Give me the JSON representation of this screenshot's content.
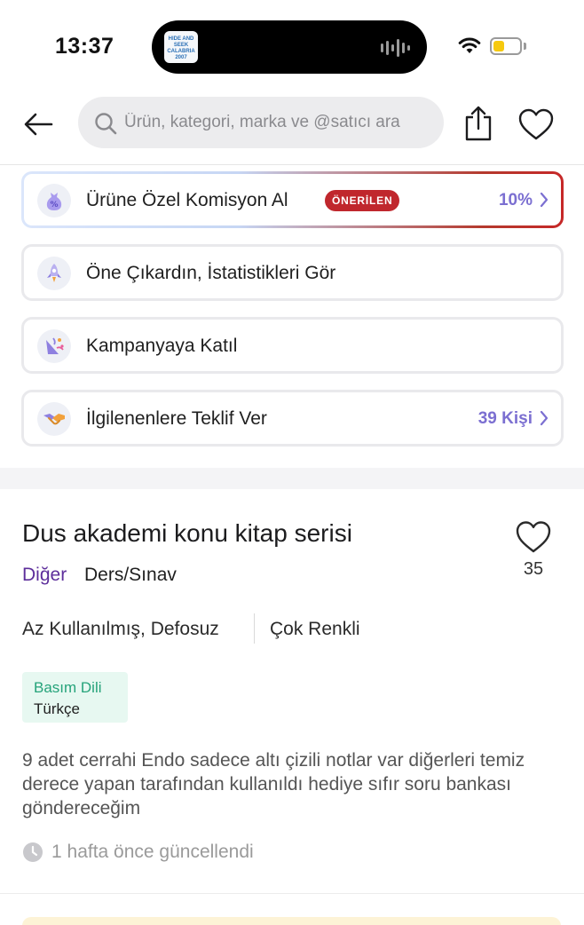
{
  "status_bar": {
    "time": "13:37",
    "now_playing_art_text": "HIDE AND SEEK CALABRIA 2007",
    "battery_level": 0.4,
    "battery_color": "#f6c90e"
  },
  "nav": {
    "back_icon": "arrow-left-icon",
    "search_placeholder": "Ürün, kategori, marka ve @satıcı ara",
    "share_icon": "share-icon",
    "favorite_icon": "heart-icon"
  },
  "actions": [
    {
      "label": "Ürüne Özel Komisyon Al",
      "badge": "ÖNERİLEN",
      "value": "10%",
      "icon": "commission-icon"
    },
    {
      "label": "Öne Çıkardın, İstatistikleri Gör",
      "icon": "rocket-icon"
    },
    {
      "label": "Kampanyaya Katıl",
      "icon": "campaign-icon"
    },
    {
      "label": "İlgilenenlere Teklif Ver",
      "value": "39 Kişi",
      "icon": "handshake-icon"
    }
  ],
  "product": {
    "title": "Dus akademi konu kitap serisi",
    "like_count": "35",
    "category": "Diğer",
    "subcategory": "Ders/Sınav",
    "condition": "Az Kullanılmış, Defosuz",
    "color": "Çok Renkli",
    "language_label": "Basım Dili",
    "language_value": "Türkçe",
    "description": "9 adet cerrahi Endo sadece altı çizili notlar var diğerleri temiz derece yapan tarafından kullanıldı hediye sıfır soru bankası göndereceğim",
    "updated": "1 hafta önce güncellendi"
  },
  "colors": {
    "accent_purple": "#7b6fd1",
    "category_purple": "#5d2e9b",
    "badge_red": "#c0272d",
    "language_green": "#25a37a"
  }
}
